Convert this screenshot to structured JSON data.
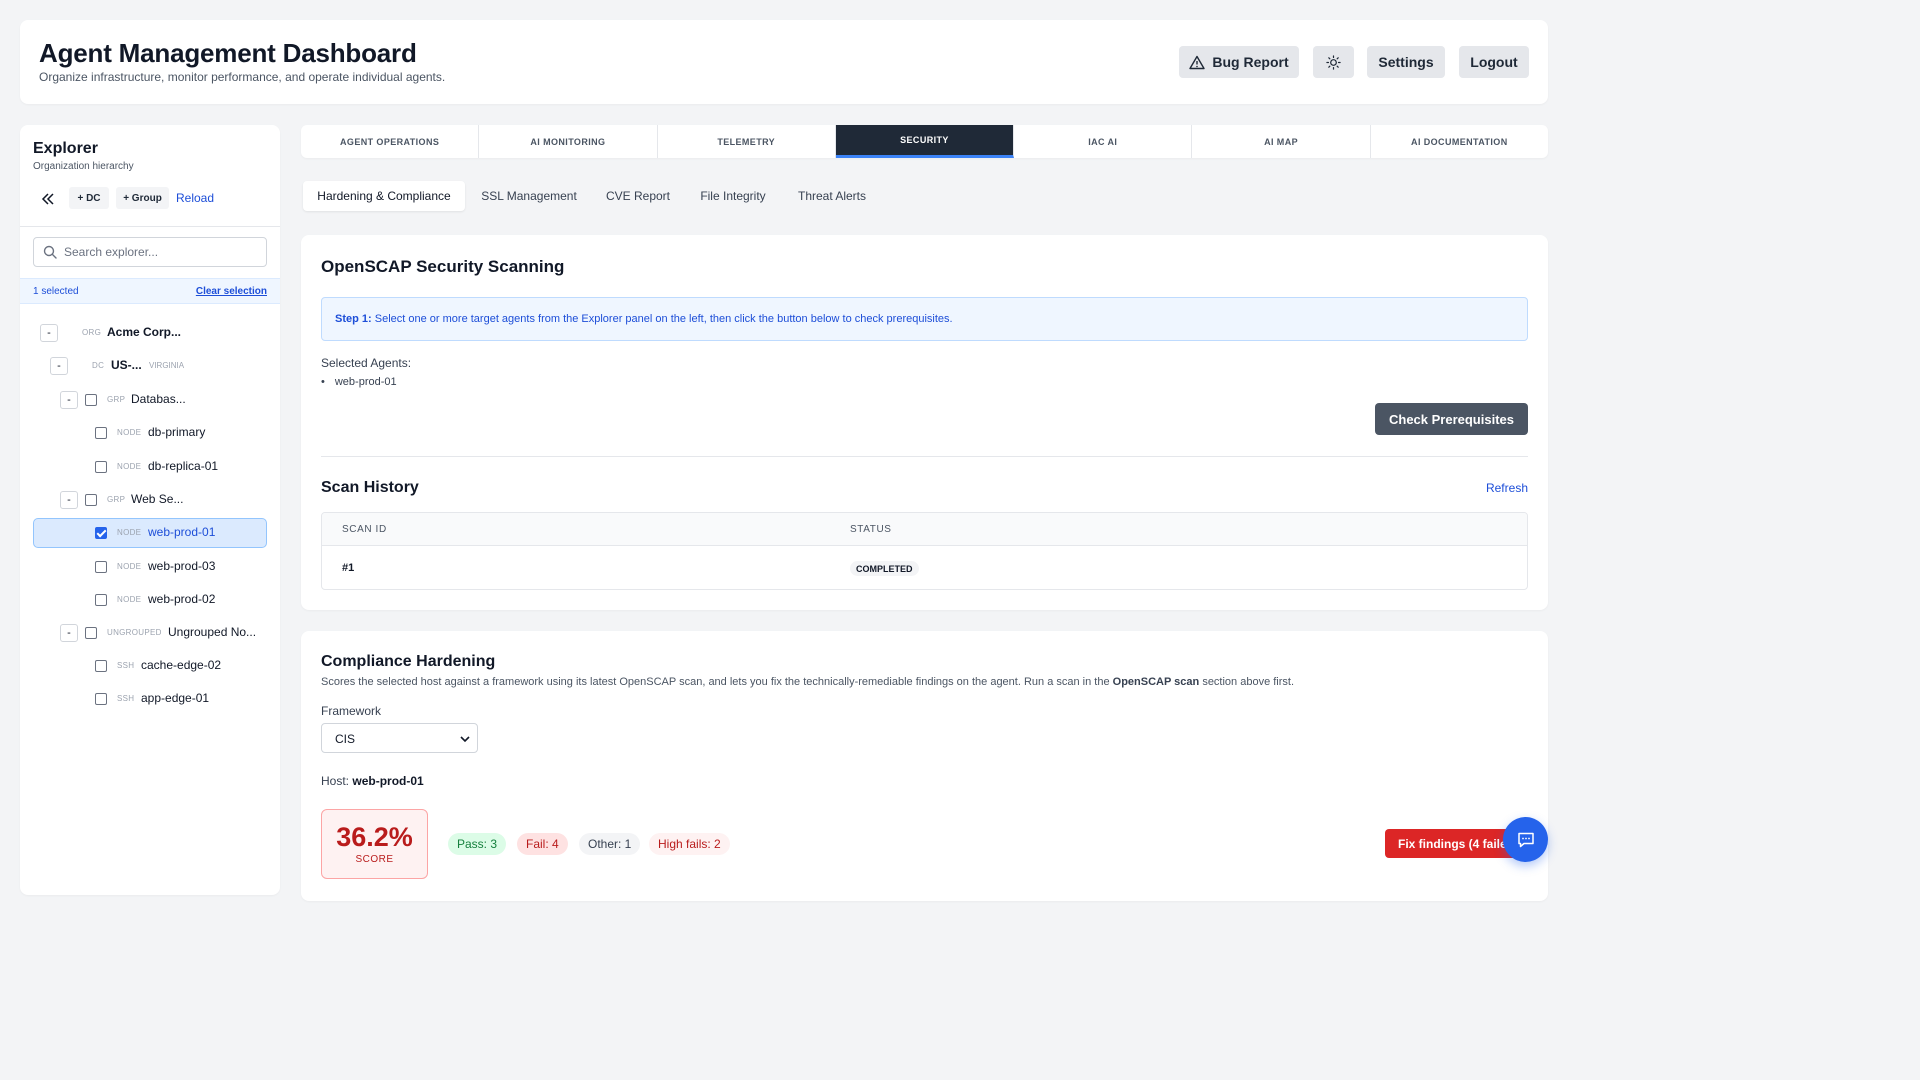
{
  "header": {
    "title": "Agent Management Dashboard",
    "subtitle": "Organize infrastructure, monitor performance, and operate individual agents.",
    "bug_report": "Bug Report",
    "settings": "Settings",
    "logout": "Logout"
  },
  "explorer": {
    "title": "Explorer",
    "subtitle": "Organization hierarchy",
    "add_dc": "+ DC",
    "add_group": "+ Group",
    "reload": "Reload",
    "search_placeholder": "Search explorer...",
    "selected_count": "1 selected",
    "clear_selection": "Clear selection",
    "tree": [
      {
        "toggle": "-",
        "type": "ORG",
        "name": "Acme Corp..."
      },
      {
        "toggle": "-",
        "type": "DC",
        "name": "US-...",
        "sub": "VIRGINIA"
      },
      {
        "toggle": "-",
        "type": "GRP",
        "name": "Databas...",
        "checked": false
      },
      {
        "type": "NODE",
        "name": "db-primary",
        "checked": false
      },
      {
        "type": "NODE",
        "name": "db-replica-01",
        "checked": false
      },
      {
        "toggle": "-",
        "type": "GRP",
        "name": "Web Se...",
        "checked": false
      },
      {
        "type": "NODE",
        "name": "web-prod-01",
        "checked": true,
        "selected": true
      },
      {
        "type": "NODE",
        "name": "web-prod-03",
        "checked": false
      },
      {
        "type": "NODE",
        "name": "web-prod-02",
        "checked": false
      },
      {
        "toggle": "-",
        "type": "UNGROUPED",
        "name": "Ungrouped No...",
        "checked": false
      },
      {
        "type": "SSH",
        "name": "cache-edge-02",
        "checked": false
      },
      {
        "type": "SSH",
        "name": "app-edge-01",
        "checked": false
      }
    ]
  },
  "tabs": [
    {
      "label": "AGENT OPERATIONS",
      "active": false
    },
    {
      "label": "AI MONITORING",
      "active": false
    },
    {
      "label": "TELEMETRY",
      "active": false
    },
    {
      "label": "SECURITY",
      "active": true
    },
    {
      "label": "IAC AI",
      "active": false
    },
    {
      "label": "AI MAP",
      "active": false
    },
    {
      "label": "AI DOCUMENTATION",
      "active": false
    }
  ],
  "subtabs": [
    {
      "label": "Hardening & Compliance",
      "active": true
    },
    {
      "label": "SSL Management",
      "active": false
    },
    {
      "label": "CVE Report",
      "active": false
    },
    {
      "label": "File Integrity",
      "active": false
    },
    {
      "label": "Threat Alerts",
      "active": false
    }
  ],
  "openscap": {
    "title": "OpenSCAP Security Scanning",
    "step_label": "Step 1:",
    "step_text": "Select one or more target agents from the Explorer panel on the left, then click the button below to check prerequisites.",
    "selected_label": "Selected Agents:",
    "selected_agents": [
      "web-prod-01"
    ],
    "check_button": "Check Prerequisites",
    "history_title": "Scan History",
    "refresh": "Refresh",
    "columns": [
      "SCAN ID",
      "STATUS"
    ],
    "rows": [
      {
        "id": "#1",
        "status": "COMPLETED"
      }
    ]
  },
  "compliance": {
    "title": "Compliance Hardening",
    "desc_pre": "Scores the selected host against a framework using its latest OpenSCAP scan, and lets you fix the technically-remediable findings on the agent. Run a scan in the",
    "desc_bold": "OpenSCAP scan",
    "desc_post": "section above first.",
    "framework_label": "Framework",
    "framework_value": "CIS",
    "host_label": "Host:",
    "host_value": "web-prod-01",
    "score": "36.2%",
    "score_label": "SCORE",
    "pass": "Pass: 3",
    "fail": "Fail: 4",
    "other": "Other: 1",
    "high_fails": "High fails: 2",
    "fix_button": "Fix findings (4 failed)"
  },
  "colors": {
    "active_tab": "#1f2937",
    "link": "#1d4ed8",
    "danger": "#dc2626",
    "chat_fab": "#2563eb"
  },
  "icons": [
    "warning-icon",
    "sun-icon",
    "double-chevron-left-icon",
    "search-icon",
    "chevron-down-icon",
    "chat-icon"
  ]
}
